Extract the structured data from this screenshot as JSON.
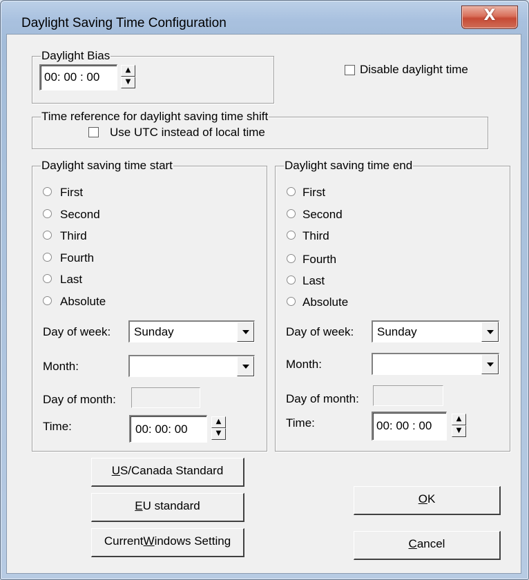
{
  "window": {
    "title": "Daylight Saving Time Configuration",
    "close_glyph": "X"
  },
  "bias": {
    "legend": "Daylight Bias",
    "value": "00: 00 : 00",
    "up": "▲",
    "down": "▼"
  },
  "disable_daylight": {
    "label": "Disable daylight time",
    "checked": false
  },
  "time_reference": {
    "legend": "Time reference for daylight saving time shift",
    "utc_label": "Use UTC instead of local time",
    "checked": false
  },
  "start": {
    "legend": "Daylight saving time start",
    "radios": [
      "First",
      "Second",
      "Third",
      "Fourth",
      "Last",
      "Absolute"
    ],
    "day_of_week_label": "Day of week:",
    "day_of_week_value": "Sunday",
    "month_label": "Month:",
    "month_value": "",
    "day_of_month_label": "Day of month:",
    "time_label": "Time:",
    "time_value": "00: 00: 00",
    "up": "▲",
    "down": "▼"
  },
  "end": {
    "legend": "Daylight saving time end",
    "radios": [
      "First",
      "Second",
      "Third",
      "Fourth",
      "Last",
      "Absolute"
    ],
    "day_of_week_label": "Day of week:",
    "day_of_week_value": "Sunday",
    "month_label": "Month:",
    "month_value": "",
    "day_of_month_label": "Day of month:",
    "time_label": "Time:",
    "time_value": "00: 00 : 00",
    "up": "▲",
    "down": "▼"
  },
  "buttons": {
    "us_canada": {
      "mnemonic": "U",
      "rest": "S/Canada Standard"
    },
    "eu": {
      "mnemonic": "E",
      "rest": "U standard"
    },
    "current_windows": {
      "before": "Current ",
      "mnemonic": "W",
      "after": "indows Setting"
    },
    "ok": {
      "mnemonic": "O",
      "rest": "K"
    },
    "cancel": {
      "mnemonic": "C",
      "rest": "ancel"
    }
  },
  "colors": {
    "frame": "#a9c1df",
    "client": "#f0f0f0",
    "close": "#c64a35"
  }
}
